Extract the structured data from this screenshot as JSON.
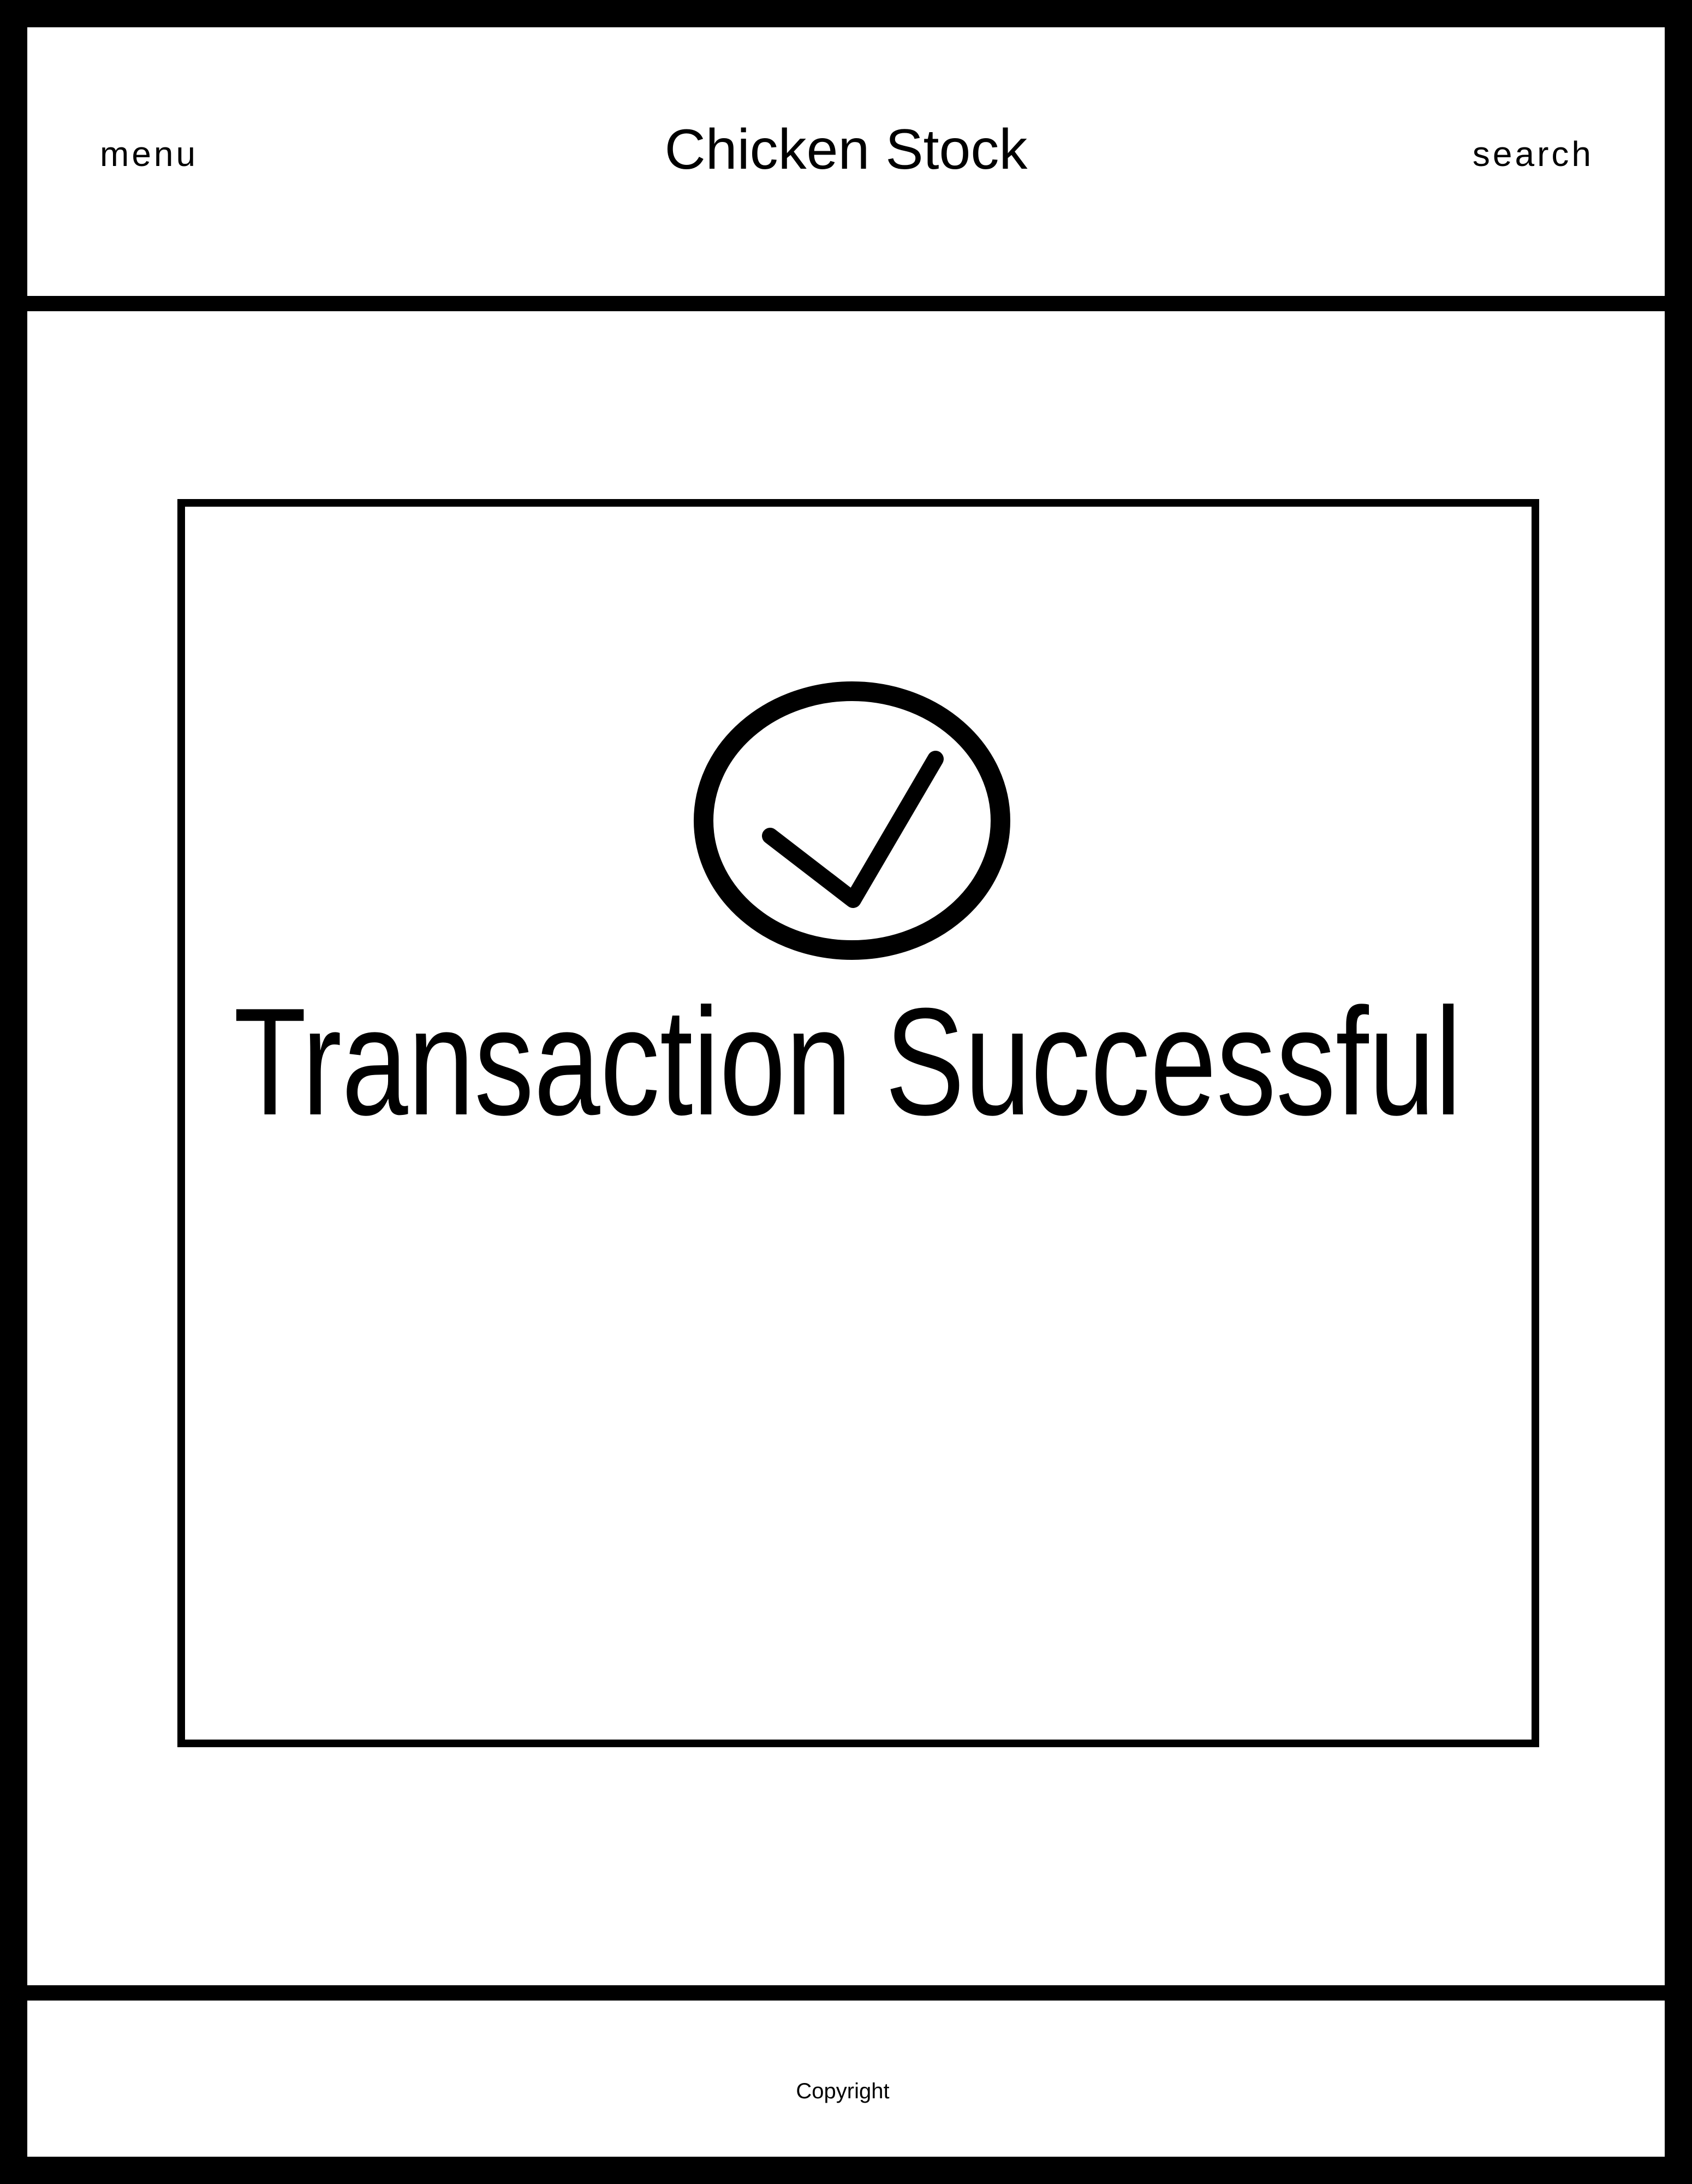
{
  "header": {
    "menu_label": "menu",
    "title": "Chicken Stock",
    "search_label": "search"
  },
  "main": {
    "status_icon": "checkmark-circle-icon",
    "message": "Transaction Successful"
  },
  "footer": {
    "copyright": "Copyright"
  },
  "colors": {
    "foreground": "#000000",
    "background": "#ffffff"
  }
}
